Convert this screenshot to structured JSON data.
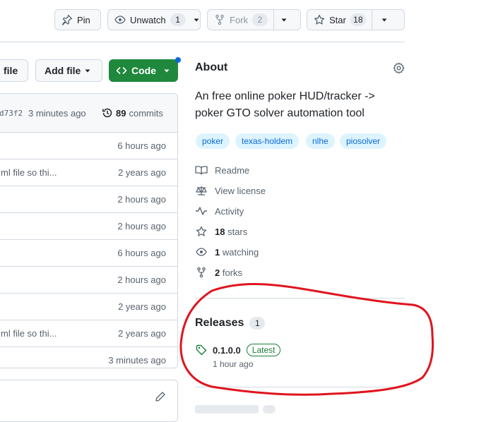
{
  "header": {
    "pin_label": "Pin",
    "unwatch_label": "Unwatch",
    "unwatch_count": "1",
    "fork_label": "Fork",
    "fork_count": "2",
    "star_label": "Star",
    "star_count": "18"
  },
  "toolbar": {
    "go_to_file_label": "file",
    "add_file_label": "Add file",
    "code_label": "Code"
  },
  "commit_bar": {
    "hash": "d73f2",
    "time": "3 minutes ago",
    "commits_count": "89",
    "commits_label": "commits"
  },
  "files": [
    {
      "message": "",
      "time": "6 hours ago"
    },
    {
      "message": "ml file so thi...",
      "time": "2 years ago"
    },
    {
      "message": "",
      "time": "2 hours ago"
    },
    {
      "message": "",
      "time": "2 hours ago"
    },
    {
      "message": "",
      "time": "6 hours ago"
    },
    {
      "message": "",
      "time": "2 hours ago"
    },
    {
      "message": "",
      "time": "2 years ago"
    },
    {
      "message": "ml file so thi...",
      "time": "2 years ago"
    },
    {
      "message": "",
      "time": "3 minutes ago"
    }
  ],
  "about": {
    "title": "About",
    "description": "An free online poker HUD/tracker -> poker GTO solver automation tool",
    "topics": [
      "poker",
      "texas-holdem",
      "nlhe",
      "piosolver"
    ],
    "readme": "Readme",
    "license": "View license",
    "activity": "Activity",
    "stars_count": "18",
    "stars_label": "stars",
    "watching_count": "1",
    "watching_label": "watching",
    "forks_count": "2",
    "forks_label": "forks"
  },
  "releases": {
    "title": "Releases",
    "count": "1",
    "tag": "0.1.0.0",
    "badge": "Latest",
    "time": "1 hour ago"
  },
  "colors": {
    "accent": "#0969da",
    "primary_button": "#1f883d",
    "annotation": "#e0141e"
  }
}
